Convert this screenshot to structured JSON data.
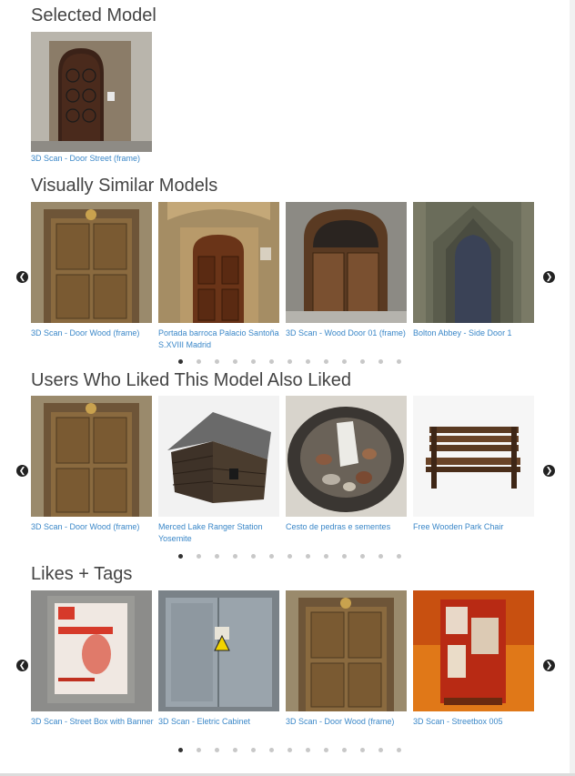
{
  "selected": {
    "heading": "Selected Model",
    "model": {
      "label": "3D Scan - Door Street (frame)"
    }
  },
  "similar": {
    "heading": "Visually Similar Models",
    "items": [
      {
        "label": "3D Scan - Door Wood (frame)"
      },
      {
        "label": "Portada barroca Palacio Santoña S.XVIII Madrid"
      },
      {
        "label": "3D Scan - Wood Door 01 (frame)"
      },
      {
        "label": "Bolton Abbey - Side Door 1"
      }
    ]
  },
  "also_liked": {
    "heading": "Users Who Liked This Model Also Liked",
    "items": [
      {
        "label": "3D Scan - Door Wood (frame)"
      },
      {
        "label": "Merced Lake Ranger Station Yosemite"
      },
      {
        "label": "Cesto de pedras e sementes"
      },
      {
        "label": "Free Wooden Park Chair"
      }
    ]
  },
  "likes_tags": {
    "heading": "Likes + Tags",
    "items": [
      {
        "label": "3D Scan - Street Box with Banner"
      },
      {
        "label": "3D Scan - Eletric Cabinet"
      },
      {
        "label": "3D Scan - Door Wood (frame)"
      },
      {
        "label": "3D Scan - Streetbox 005"
      }
    ]
  },
  "carousel": {
    "prev_glyph": "❮",
    "next_glyph": "❯",
    "page_count": 13,
    "active_page": 1
  },
  "icons": [
    "door-image-icon",
    "cabin-image-icon",
    "basket-image-icon",
    "bench-image-icon",
    "streetbox-image-icon",
    "cabinet-image-icon"
  ]
}
